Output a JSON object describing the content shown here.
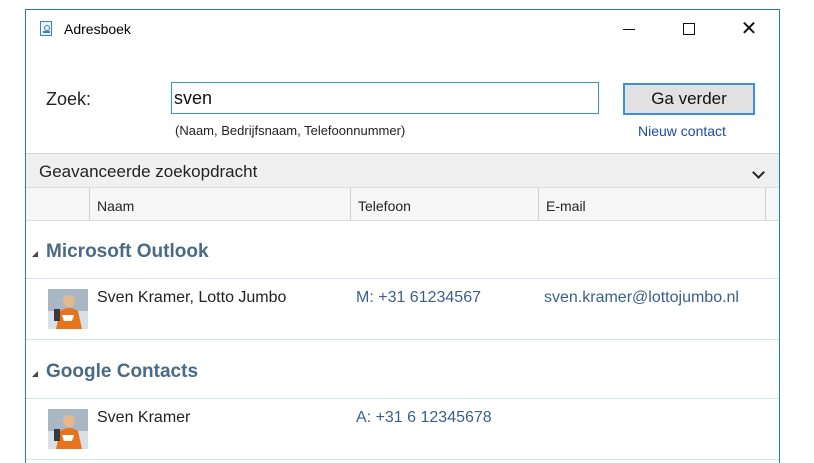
{
  "window": {
    "title": "Adresboek",
    "minimize_glyph": "minimize-icon",
    "maximize_glyph": "maximize-icon",
    "close_glyph": "✕"
  },
  "search": {
    "label": "Zoek:",
    "value": "sven",
    "hint": "(Naam, Bedrijfsnaam, Telefoonnummer)",
    "go_button": "Ga verder",
    "new_contact": "Nieuw contact"
  },
  "advanced": {
    "label": "Geavanceerde zoekopdracht",
    "icon": "chevron-down-icon"
  },
  "columns": {
    "name": "Naam",
    "phone": "Telefoon",
    "email": "E-mail"
  },
  "groups": [
    {
      "title": "Microsoft Outlook",
      "contacts": [
        {
          "name": "Sven Kramer, Lotto Jumbo",
          "phone": "M: +31 61234567",
          "email": "sven.kramer@lottojumbo.nl"
        }
      ]
    },
    {
      "title": "Google Contacts",
      "contacts": [
        {
          "name": "Sven Kramer",
          "phone": "A: +31 6 12345678",
          "email": ""
        }
      ]
    }
  ],
  "colors": {
    "accent": "#3d8de0",
    "group_title": "#4a6a85",
    "link": "#1f4aa0",
    "row_value": "#3a5f8f"
  }
}
